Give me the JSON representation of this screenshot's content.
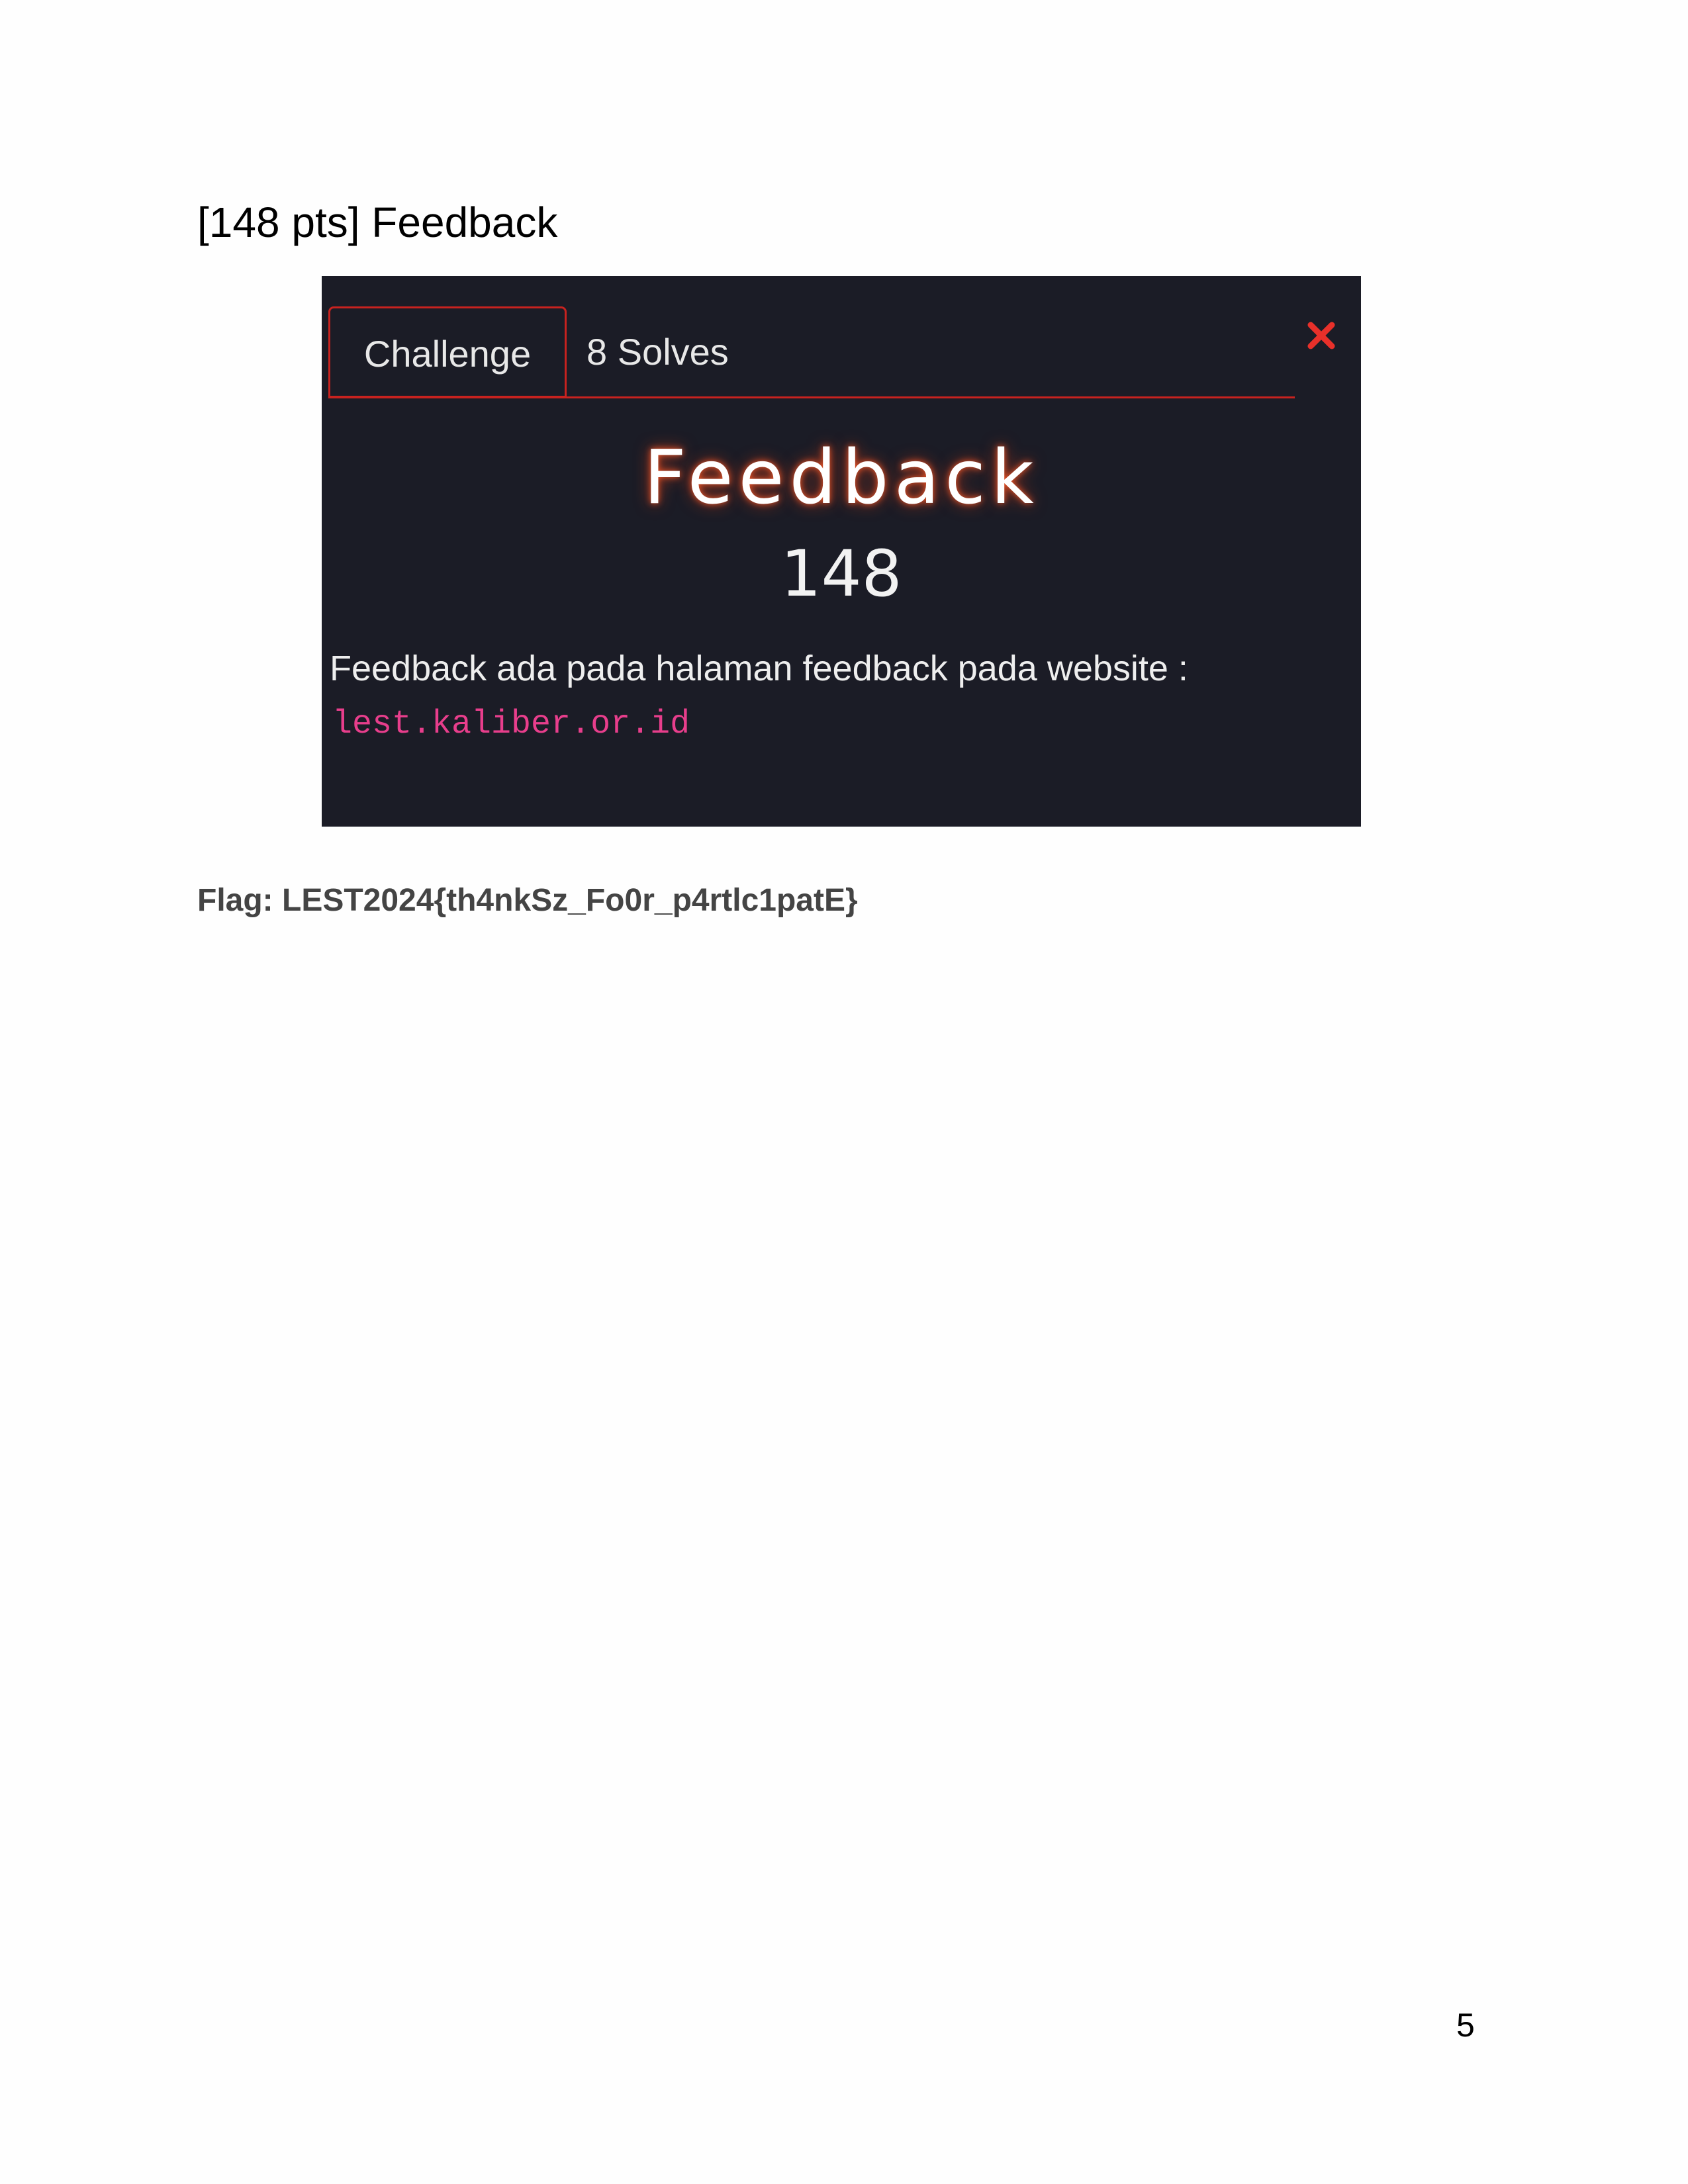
{
  "heading": "[148 pts] Feedback",
  "screenshot": {
    "tabs": {
      "challenge_label": "Challenge",
      "solves_label": "8 Solves"
    },
    "close_icon": "close-icon",
    "title": "Feedback",
    "value": "148",
    "description": "Feedback ada pada halaman feedback pada website :",
    "link": "lest.kaliber.or.id",
    "colors": {
      "background": "#1b1c26",
      "accent_red": "#c8221f",
      "link_pink": "#e83e8c"
    }
  },
  "flag": "Flag: LEST2024{th4nkSz_Fo0r_p4rtlc1patE}",
  "page_number": "5"
}
